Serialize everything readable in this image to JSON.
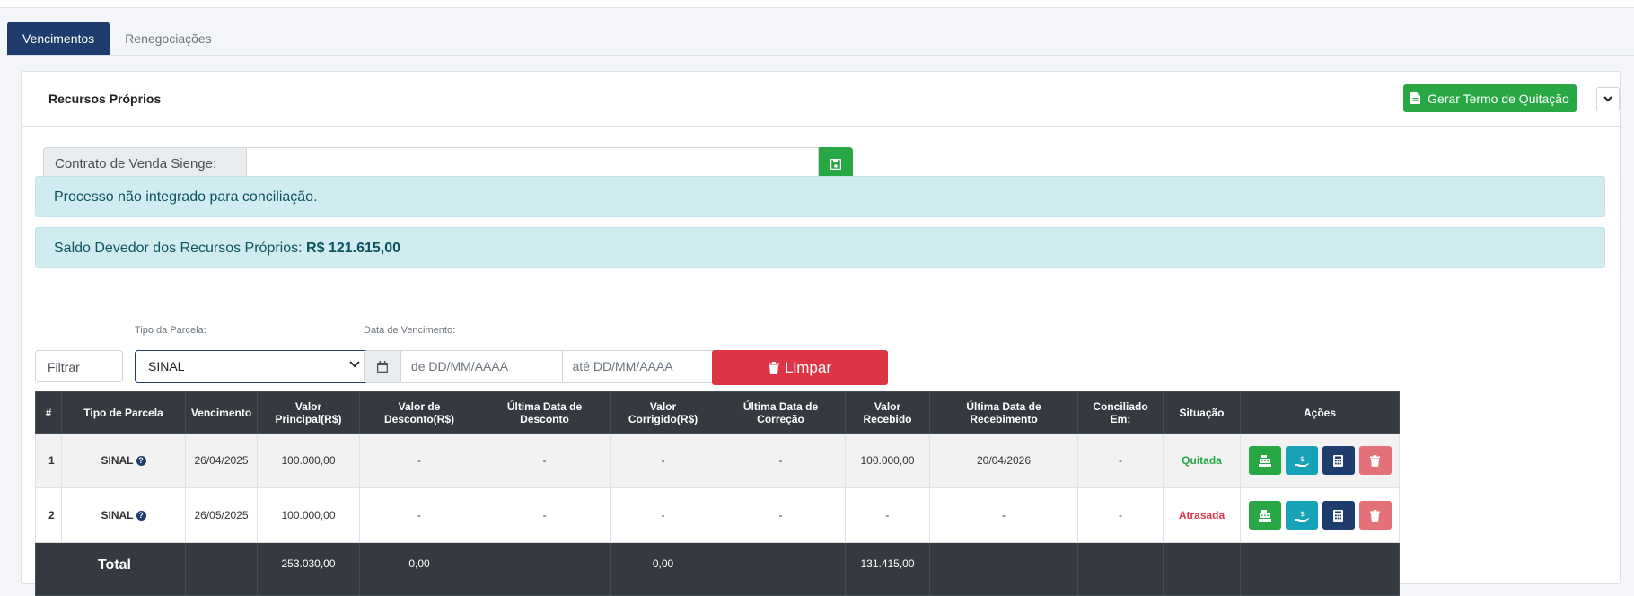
{
  "tabs": [
    {
      "label": "Vencimentos",
      "active": true
    },
    {
      "label": "Renegociações",
      "active": false
    }
  ],
  "panel": {
    "title": "Recursos Próprios",
    "quit_button_label": "Gerar Termo de Quitação",
    "contract_label": "Contrato de Venda Sienge:",
    "contract_value": ""
  },
  "alerts": {
    "not_integrated": "Processo não integrado para conciliação.",
    "balance_label": "Saldo Devedor dos Recursos Próprios:",
    "balance_value": "R$ 121.615,00"
  },
  "filters": {
    "filter_placeholder": "Filtrar",
    "tipo_label": "Tipo da Parcela:",
    "tipo_selected": "SINAL",
    "date_label": "Data de Vencimento:",
    "date_from": "de  DD/MM/AAAA",
    "date_to": "até  DD/MM/AAAA",
    "clear_label": "Limpar"
  },
  "table": {
    "headers": [
      "#",
      "Tipo de Parcela",
      "Vencimento",
      "Valor Principal(R$)",
      "Valor de Desconto(R$)",
      "Última Data de Desconto",
      "Valor Corrigido(R$)",
      "Última Data de Correção",
      "Valor Recebido",
      "Última Data de Recebimento",
      "Conciliado Em:",
      "Situação",
      "Ações"
    ],
    "rows": [
      {
        "num": "1",
        "tipo": "SINAL",
        "vencimento": "26/04/2025",
        "principal": "100.000,00",
        "desconto": "-",
        "data_desconto": "-",
        "corrigido": "-",
        "data_correcao": "-",
        "recebido": "100.000,00",
        "data_recebimento": "20/04/2026",
        "conciliado": "-",
        "situacao": "Quitada"
      },
      {
        "num": "2",
        "tipo": "SINAL",
        "vencimento": "26/05/2025",
        "principal": "100.000,00",
        "desconto": "-",
        "data_desconto": "-",
        "corrigido": "-",
        "data_correcao": "-",
        "recebido": "-",
        "data_recebimento": "-",
        "conciliado": "-",
        "situacao": "Atrasada"
      }
    ],
    "footer": {
      "label": "Total",
      "principal": "253.030,00",
      "desconto": "0,00",
      "corrigido": "0,00",
      "recebido": "131.415,00"
    }
  },
  "colors": {
    "primary": "#1f3c6e",
    "success": "#28a745",
    "danger": "#dc3545",
    "info_bg": "#d1ecf1",
    "table_head": "#343a40"
  },
  "icons": [
    "file-icon",
    "chevron-down-icon",
    "save-icon",
    "calendar-icon",
    "trash-icon",
    "question-icon",
    "cash-register-icon",
    "hand-money-icon",
    "calculator-icon"
  ]
}
